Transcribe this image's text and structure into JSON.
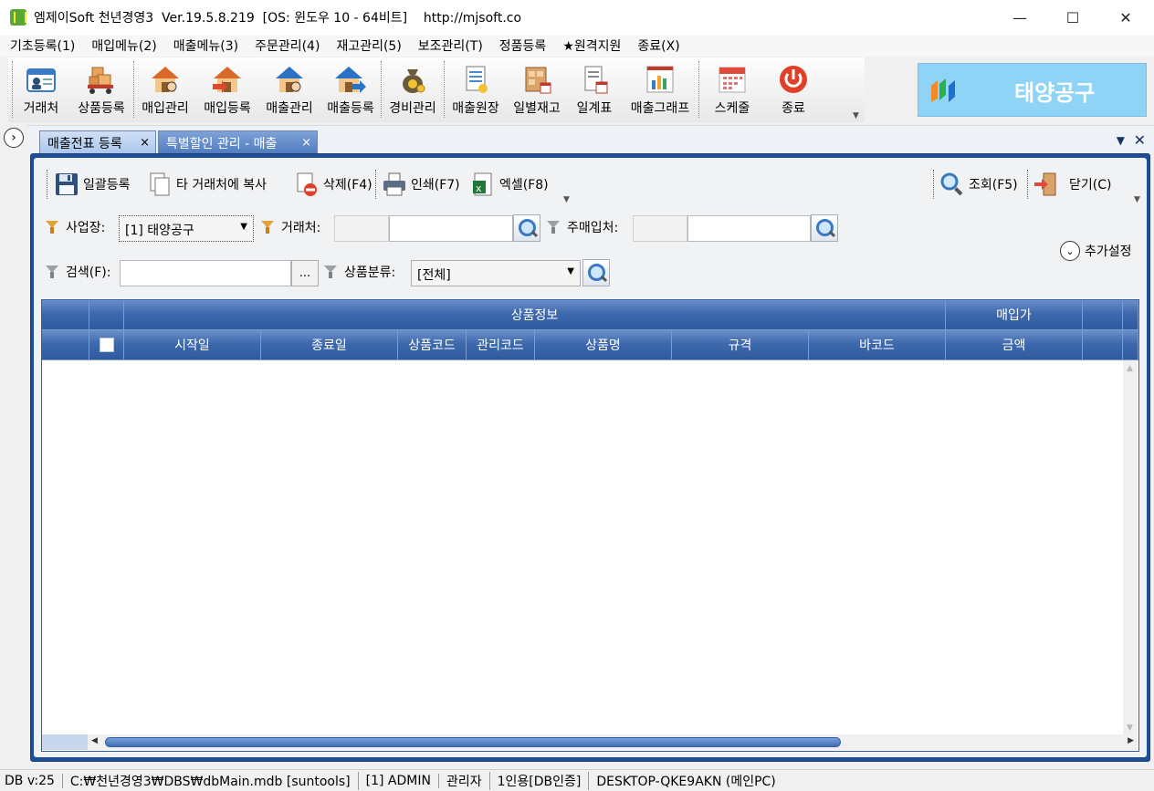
{
  "window": {
    "title": "엠제이Soft 천년경영3  Ver.19.5.8.219  [OS: 윈도우 10 - 64비트]    http://mjsoft.co",
    "minimize": "—",
    "maximize": "☐",
    "close": "✕"
  },
  "menu": [
    "기초등록(1)",
    "매입메뉴(2)",
    "매출메뉴(3)",
    "주문관리(4)",
    "재고관리(5)",
    "보조관리(T)",
    "정품등록",
    "★원격지원",
    "종료(X)"
  ],
  "toolbar": [
    {
      "label": "거래처",
      "icon": "contact-card-icon"
    },
    {
      "label": "상품등록",
      "icon": "boxes-cart-icon"
    },
    {
      "label": "매입관리",
      "icon": "house-icon"
    },
    {
      "label": "매입등록",
      "icon": "house-arrow-in-icon"
    },
    {
      "label": "매출관리",
      "icon": "house-blue-icon"
    },
    {
      "label": "매출등록",
      "icon": "house-arrow-out-icon"
    },
    {
      "label": "경비관리",
      "icon": "money-bag-icon"
    },
    {
      "label": "매출원장",
      "icon": "ledger-icon"
    },
    {
      "label": "일별재고",
      "icon": "inventory-icon"
    },
    {
      "label": "일계표",
      "icon": "daily-report-icon"
    },
    {
      "label": "매출그래프",
      "icon": "bar-chart-icon"
    },
    {
      "label": "스케줄",
      "icon": "calendar-icon"
    },
    {
      "label": "종료",
      "icon": "power-icon"
    }
  ],
  "brand": {
    "name": "태양공구"
  },
  "tabs": [
    {
      "label": "매출전표 등록",
      "close": "×"
    },
    {
      "label": "특별할인 관리 - 매출",
      "close": "×"
    }
  ],
  "tab_controls": {
    "list": "▼",
    "close": "✕"
  },
  "actions": {
    "bulk_register": "일괄등록",
    "copy_to_other": "타 거래처에 복사",
    "delete": "삭제(F4)",
    "print": "인쇄(F7)",
    "excel": "엑셀(F8)",
    "search": "조회(F5)",
    "close": "닫기(C)"
  },
  "filters": {
    "business_label": "사업장:",
    "business_value": "[1] 태양공구",
    "customer_label": "거래처:",
    "customer_code": "",
    "customer_name": "",
    "main_supplier_label": "주매입처:",
    "main_supplier_code": "",
    "main_supplier_name": "",
    "search_label": "검색(F):",
    "search_value": "",
    "dots": "...",
    "category_label": "상품분류:",
    "category_value": "[전체]",
    "extra_settings": "추가설정",
    "chevron": "⌄"
  },
  "grid": {
    "group_headers": {
      "product_info": "상품정보",
      "purchase_price": "매입가"
    },
    "columns": [
      "시작일",
      "종료일",
      "상품코드",
      "관리코드",
      "상품명",
      "규격",
      "바코드",
      "금액"
    ],
    "rows": []
  },
  "status": [
    "DB v:25",
    "C:₩천년경영3₩DBS₩dbMain.mdb [suntools]",
    "[1] ADMIN",
    "관리자",
    "1인용[DB인증]",
    "DESKTOP-QKE9AKN (메인PC)"
  ],
  "colors": {
    "accent": "#1e4f95",
    "header": "#3f69ad",
    "brand": "#8fd3f7"
  }
}
